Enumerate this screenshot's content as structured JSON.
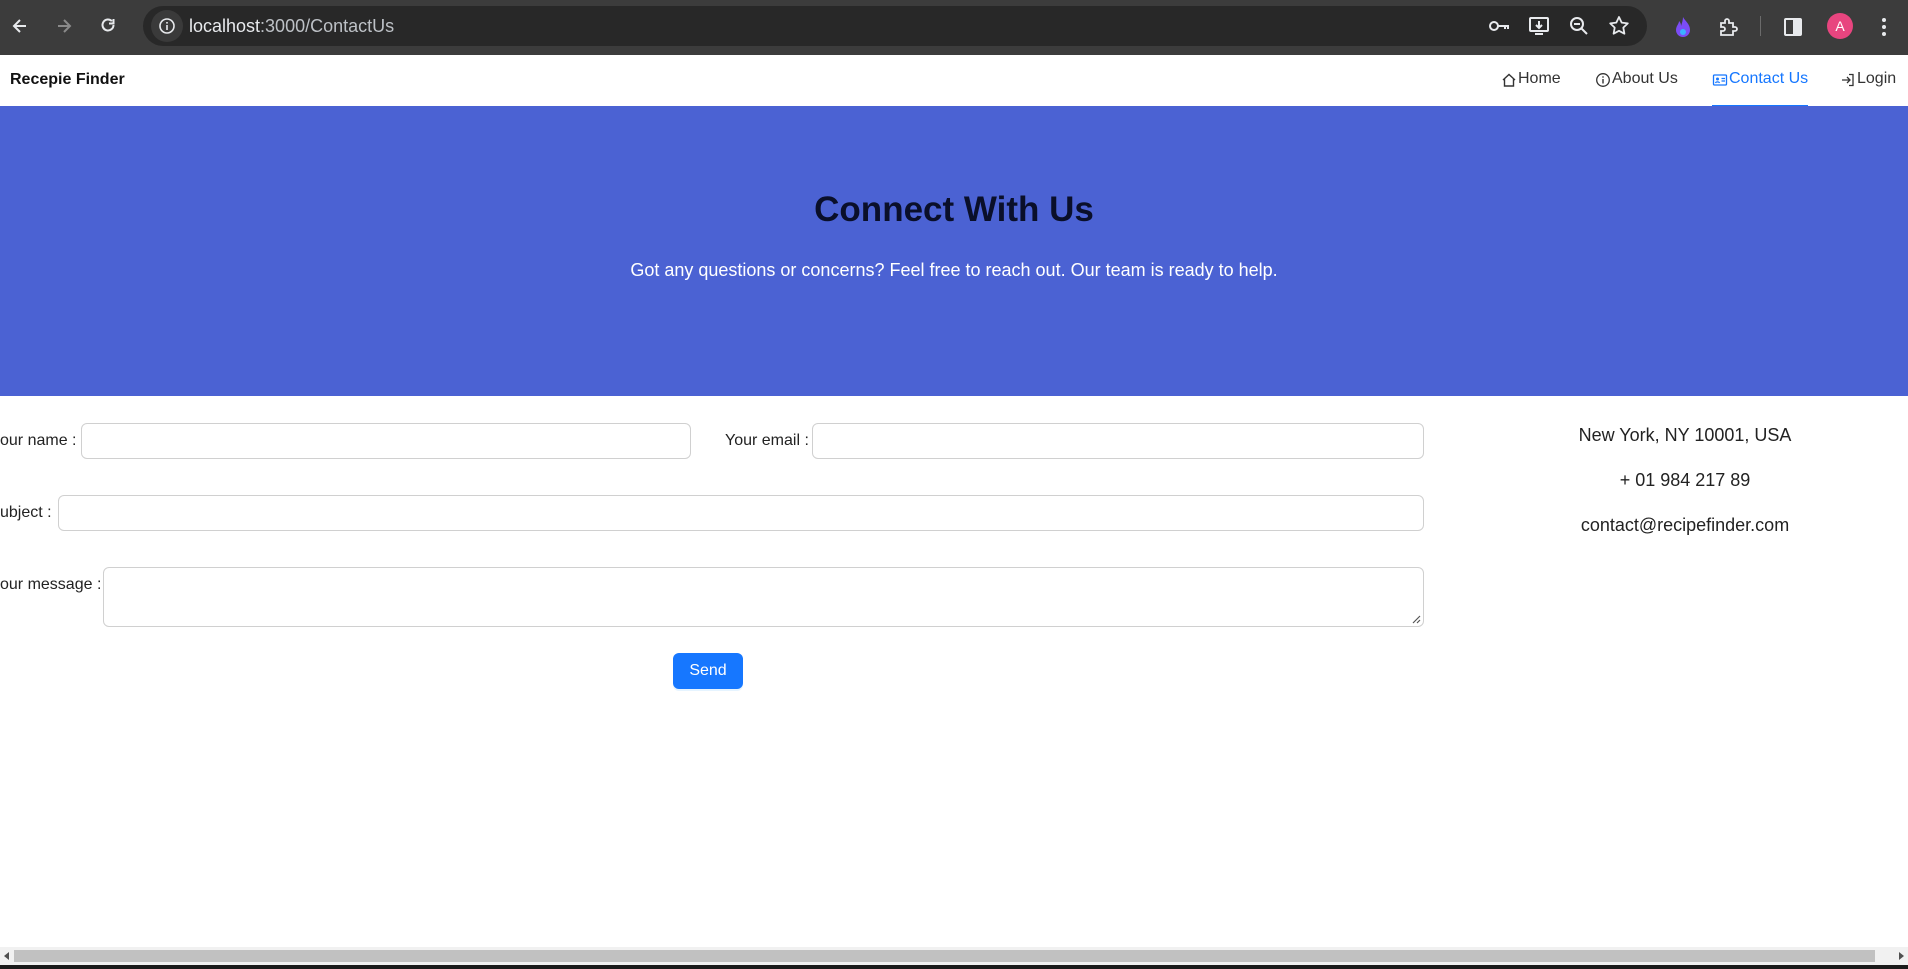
{
  "browser": {
    "url_host": "localhost",
    "url_path": ":3000/ContactUs",
    "profile_initial": "A",
    "icons": [
      "back-icon",
      "forward-icon",
      "reload-icon",
      "site-info-icon",
      "password-key-icon",
      "install-app-icon",
      "zoom-icon",
      "bookmark-star-icon",
      "extension-flame-icon",
      "extensions-puzzle-icon",
      "side-panel-icon",
      "profile-avatar",
      "kebab-menu-icon"
    ]
  },
  "nav": {
    "brand": "Recepie Finder",
    "items": [
      {
        "label": "Home",
        "icon": "home-icon"
      },
      {
        "label": "About Us",
        "icon": "info-icon"
      },
      {
        "label": "Contact Us",
        "icon": "contact-card-icon",
        "active": true
      },
      {
        "label": "Login",
        "icon": "login-icon"
      }
    ],
    "accent": "#1677ff"
  },
  "hero": {
    "title": "Connect With Us",
    "subtitle": "Got any questions or concerns? Feel free to reach out. Our team is ready to help.",
    "background": "#4b62d3"
  },
  "form": {
    "name_label": "our name",
    "email_label": "Your email",
    "subject_label": "ubject",
    "message_label": "our message",
    "name_value": "",
    "email_value": "",
    "subject_value": "",
    "message_value": "",
    "colon": ":",
    "send_label": "Send"
  },
  "contact": {
    "address": "New York, NY 10001, USA",
    "phone": "+ 01 984 217 89",
    "email": "contact@recipefinder.com"
  }
}
